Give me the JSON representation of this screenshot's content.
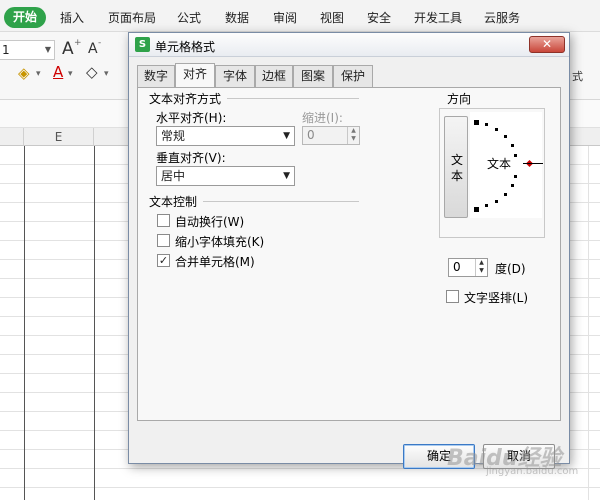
{
  "menubar": {
    "start": "开始",
    "items": [
      "插入",
      "页面布局",
      "公式",
      "数据",
      "审阅",
      "视图",
      "安全",
      "开发工具",
      "云服务"
    ]
  },
  "ribbon": {
    "font_size": "1",
    "grow_font": "A",
    "shrink_font": "A",
    "font_color_glyph": "A",
    "style_label": "式"
  },
  "sheet": {
    "column_e": "E"
  },
  "dialog": {
    "title": "单元格格式",
    "close": "✕",
    "tabs": [
      "数字",
      "对齐",
      "字体",
      "边框",
      "图案",
      "保护"
    ],
    "active_tab": "对齐",
    "text_alignment": {
      "group_title": "文本对齐方式",
      "horizontal_label": "水平对齐(H):",
      "horizontal_value": "常规",
      "indent_label": "缩进(I):",
      "indent_value": "0",
      "vertical_label": "垂直对齐(V):",
      "vertical_value": "居中"
    },
    "text_control": {
      "group_title": "文本控制",
      "wrap_text": {
        "label": "自动换行(W)",
        "checked": false
      },
      "shrink_to_fit": {
        "label": "缩小字体填充(K)",
        "checked": false
      },
      "merge_cells": {
        "label": "合并单元格(M)",
        "checked": true
      }
    },
    "orientation": {
      "group_title": "方向",
      "vertical_text": [
        "文",
        "本"
      ],
      "dial_text": "文本",
      "degrees_value": "0",
      "degrees_label": "度(D)",
      "vertical_layout": {
        "label": "文字竖排(L)",
        "checked": false
      }
    },
    "buttons": {
      "ok": "确定",
      "cancel": "取消"
    }
  },
  "watermark": {
    "text": "Baidu经验",
    "url": "jingyan.baidu.com"
  }
}
